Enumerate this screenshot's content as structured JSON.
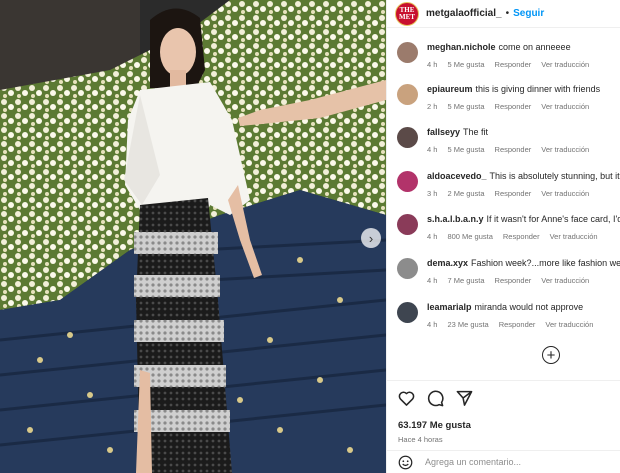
{
  "post": {
    "username": "metgalaofficial_",
    "separator": "•",
    "follow_label": "Seguir",
    "brand_avatar_line1": "THE",
    "brand_avatar_line2": "MET"
  },
  "comments": [
    {
      "user": "meghan.nichole",
      "text": "come on anneeee",
      "time": "4 h",
      "likes": "5 Me gusta",
      "reply": "Responder",
      "translate": "Ver traducción",
      "avatar_color": "#9b7b6c"
    },
    {
      "user": "epiaureum",
      "text": "this is giving dinner with friends",
      "time": "2 h",
      "likes": "5 Me gusta",
      "reply": "Responder",
      "translate": "Ver traducción",
      "avatar_color": "#c9a27e"
    },
    {
      "user": "fallseyy",
      "text": "The fit",
      "time": "4 h",
      "likes": "5 Me gusta",
      "reply": "Responder",
      "translate": "Ver traducción",
      "avatar_color": "#5b4a48"
    },
    {
      "user": "aldoacevedo_",
      "text": "This is absolutely stunning, but it's giving me mom at my sister's quinceañera",
      "time": "3 h",
      "likes": "2 Me gusta",
      "reply": "Responder",
      "translate": "Ver traducción",
      "avatar_color": "#b2336a"
    },
    {
      "user": "s.h.a.l.b.a.n.y",
      "text": "If it wasn't for Anne's face card, I'd be laughing",
      "time": "4 h",
      "likes": "800 Me gusta",
      "reply": "Responder",
      "translate": "Ver traducción",
      "avatar_color": "#8a3b59"
    },
    {
      "user": "dema.xyx",
      "text": "Fashion week?...more like fashion weak",
      "time": "4 h",
      "likes": "7 Me gusta",
      "reply": "Responder",
      "translate": "Ver traducción",
      "avatar_color": "#8c8c8c"
    },
    {
      "user": "leamarialp",
      "text": "miranda would not approve",
      "time": "4 h",
      "likes": "23 Me gusta",
      "reply": "Responder",
      "translate": "Ver traducción",
      "avatar_color": "#3e4550"
    }
  ],
  "footer": {
    "likes_count": "63.197 Me gusta",
    "posted": "Hace 4 horas",
    "comment_placeholder": "Agrega un comentario..."
  },
  "carousel": {
    "next_icon": "chevron-right-icon",
    "current_page": 2,
    "page_count": 4
  },
  "colors": {
    "follow": "#0095f6",
    "brand_red": "#c8102e",
    "meta_gray": "#737373"
  }
}
